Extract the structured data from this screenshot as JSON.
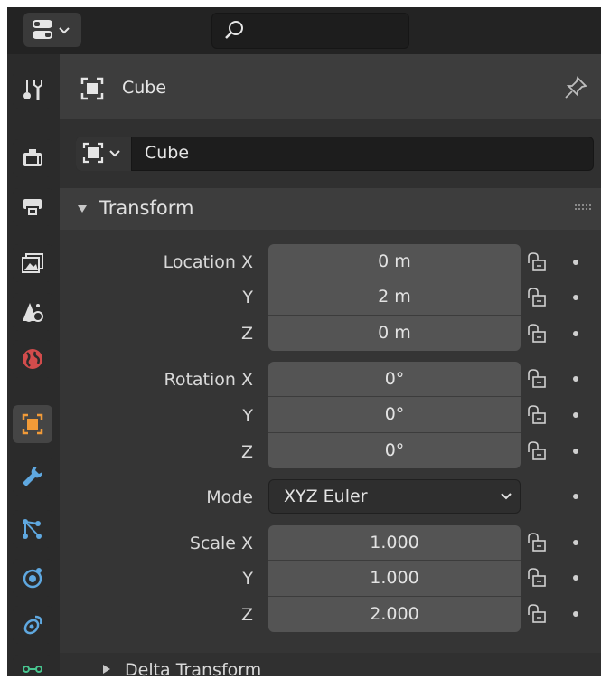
{
  "header": {
    "object_name": "Cube"
  },
  "datablock": {
    "name": "Cube"
  },
  "sidebar": {
    "tabs": [
      "tool-tab",
      "render-tab",
      "output-tab",
      "view-layer-tab",
      "scene-tab",
      "world-tab",
      "object-tab",
      "modifiers-tab",
      "particles-tab",
      "physics-tab",
      "constraints-tab",
      "data-tab"
    ],
    "active": "object-tab"
  },
  "transform": {
    "title": "Transform",
    "location": {
      "label_x": "Location X",
      "label_y": "Y",
      "label_z": "Z",
      "x": "0 m",
      "y": "2 m",
      "z": "0 m"
    },
    "rotation": {
      "label_x": "Rotation X",
      "label_y": "Y",
      "label_z": "Z",
      "x": "0°",
      "y": "0°",
      "z": "0°"
    },
    "mode": {
      "label": "Mode",
      "value": "XYZ Euler"
    },
    "scale": {
      "label_x": "Scale X",
      "label_y": "Y",
      "label_z": "Z",
      "x": "1.000",
      "y": "1.000",
      "z": "2.000"
    }
  },
  "delta_transform": {
    "title": "Delta Transform"
  },
  "colors": {
    "accent": "#f29b38",
    "world": "#d24c4c",
    "tool": "#5fa8e0"
  }
}
